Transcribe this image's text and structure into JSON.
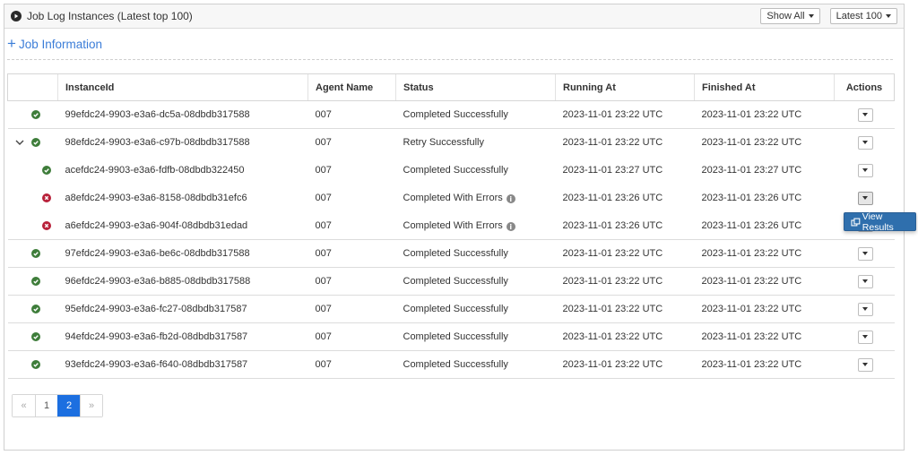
{
  "panel": {
    "title": "Job Log Instances (Latest top 100)",
    "show_all_label": "Show All",
    "latest_label": "Latest 100"
  },
  "job_info": {
    "label": "Job Information"
  },
  "table": {
    "columns": [
      "InstanceId",
      "Agent Name",
      "Status",
      "Running At",
      "Finished At",
      "Actions"
    ],
    "rows": [
      {
        "instance_id": "99efdc24-9903-e3a6-dc5a-08dbdb317588",
        "agent": "007",
        "status": "Completed Successfully",
        "running_at": "2023-11-01 23:22 UTC",
        "finished_at": "2023-11-01 23:22 UTC",
        "state": "success",
        "level": 0
      },
      {
        "instance_id": "98efdc24-9903-e3a6-c97b-08dbdb317588",
        "agent": "007",
        "status": "Retry Successfully",
        "running_at": "2023-11-01 23:22 UTC",
        "finished_at": "2023-11-01 23:22 UTC",
        "state": "success",
        "level": 0,
        "expanded": true
      },
      {
        "instance_id": "acefdc24-9903-e3a6-fdfb-08dbdb322450",
        "agent": "007",
        "status": "Completed Successfully",
        "running_at": "2023-11-01 23:27 UTC",
        "finished_at": "2023-11-01 23:27 UTC",
        "state": "success",
        "level": 1
      },
      {
        "instance_id": "a8efdc24-9903-e3a6-8158-08dbdb31efc6",
        "agent": "007",
        "status": "Completed With Errors",
        "running_at": "2023-11-01 23:26 UTC",
        "finished_at": "2023-11-01 23:26 UTC",
        "state": "error",
        "level": 1
      },
      {
        "instance_id": "a6efdc24-9903-e3a6-904f-08dbdb31edad",
        "agent": "007",
        "status": "Completed With Errors",
        "running_at": "2023-11-01 23:26 UTC",
        "finished_at": "2023-11-01 23:26 UTC",
        "state": "error",
        "level": 1
      },
      {
        "instance_id": "97efdc24-9903-e3a6-be6c-08dbdb317588",
        "agent": "007",
        "status": "Completed Successfully",
        "running_at": "2023-11-01 23:22 UTC",
        "finished_at": "2023-11-01 23:22 UTC",
        "state": "success",
        "level": 0
      },
      {
        "instance_id": "96efdc24-9903-e3a6-b885-08dbdb317588",
        "agent": "007",
        "status": "Completed Successfully",
        "running_at": "2023-11-01 23:22 UTC",
        "finished_at": "2023-11-01 23:22 UTC",
        "state": "success",
        "level": 0
      },
      {
        "instance_id": "95efdc24-9903-e3a6-fc27-08dbdb317587",
        "agent": "007",
        "status": "Completed Successfully",
        "running_at": "2023-11-01 23:22 UTC",
        "finished_at": "2023-11-01 23:22 UTC",
        "state": "success",
        "level": 0
      },
      {
        "instance_id": "94efdc24-9903-e3a6-fb2d-08dbdb317587",
        "agent": "007",
        "status": "Completed Successfully",
        "running_at": "2023-11-01 23:22 UTC",
        "finished_at": "2023-11-01 23:22 UTC",
        "state": "success",
        "level": 0
      },
      {
        "instance_id": "93efdc24-9903-e3a6-f640-08dbdb317587",
        "agent": "007",
        "status": "Completed Successfully",
        "running_at": "2023-11-01 23:22 UTC",
        "finished_at": "2023-11-01 23:22 UTC",
        "state": "success",
        "level": 0
      }
    ]
  },
  "actions_menu": {
    "view_results_label": "View Results",
    "open_for_row": 3
  },
  "pagination": {
    "prev": "«",
    "pages": [
      "1",
      "2"
    ],
    "current": "2",
    "next": "»"
  },
  "colors": {
    "accent": "#3b7dd8",
    "success": "#3e7d3a",
    "error": "#b8213a",
    "active_page": "#1c6fe0",
    "menu": "#2f6fad"
  },
  "icons": {
    "header": "play-circle-icon",
    "success": "check-circle-icon",
    "error": "x-circle-icon",
    "info": "info-icon",
    "expand": "chevron-down-icon",
    "view_results": "external-link-icon"
  }
}
